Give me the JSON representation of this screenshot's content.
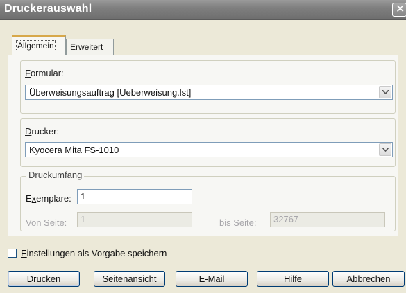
{
  "window": {
    "title": "Druckerauswahl",
    "close_glyph": "✕"
  },
  "tabs": [
    {
      "label": "Allgemein",
      "active": true
    },
    {
      "label": "Erweitert",
      "active": false
    }
  ],
  "formular": {
    "label_underlined": "F",
    "label_rest": "ormular:",
    "value": "Überweisungsauftrag [Ueberweisung.lst]"
  },
  "drucker": {
    "label_underlined": "D",
    "label_rest": "rucker:",
    "value": "Kyocera Mita FS-1010"
  },
  "druckumfang": {
    "legend": "Druckumfang",
    "exemplare_label_pre": "E",
    "exemplare_label_underlined": "x",
    "exemplare_label_rest": "emplare:",
    "exemplare_value": "1",
    "von_label_underlined": "V",
    "von_label_rest": "on Seite:",
    "von_value": "1",
    "bis_label_underlined": "b",
    "bis_label_rest": "is Seite:",
    "bis_value": "32767"
  },
  "checkbox": {
    "label_underlined": "E",
    "label_rest": "instellungen als Vorgabe speichern",
    "checked": false
  },
  "buttons": {
    "drucken_u": "D",
    "drucken_rest": "rucken",
    "seitenansicht_u": "S",
    "seitenansicht_rest": "eitenansicht",
    "email_pre": "E-",
    "email_u": "M",
    "email_rest": "ail",
    "hilfe_u": "H",
    "hilfe_rest": "ilfe",
    "abbrechen": "Abbrechen"
  },
  "colors": {
    "titlebar": "#7f7f7f",
    "active_tab_accent": "#d7a84a",
    "input_border": "#7f9db9"
  }
}
